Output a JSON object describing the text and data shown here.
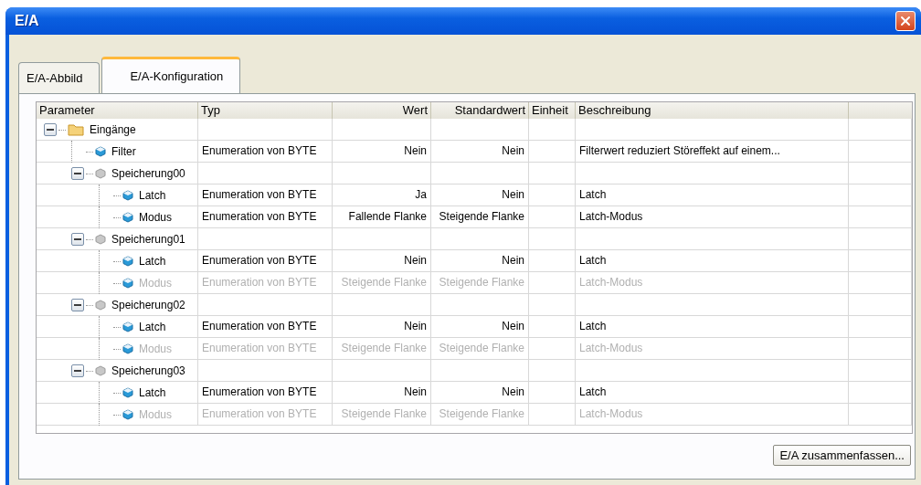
{
  "window": {
    "title": "E/A"
  },
  "tabs": [
    {
      "label": "E/A-Abbild",
      "selected": false
    },
    {
      "label": "E/A-Konfiguration",
      "selected": true
    }
  ],
  "table": {
    "columns": [
      "Parameter",
      "Typ",
      "Wert",
      "Standardwert",
      "Einheit",
      "Beschreibung"
    ],
    "rows": [
      {
        "kind": "folder",
        "name": "Eingänge",
        "expanded": true,
        "children": [
          {
            "kind": "leaf",
            "name": "Filter",
            "typ": "Enumeration von BYTE",
            "wert": "Nein",
            "standardwert": "Nein",
            "beschreibung": "Filterwert reduziert Störeffekt auf einem...",
            "disabled": false
          },
          {
            "kind": "group",
            "name": "Speicherung00",
            "expanded": true,
            "children": [
              {
                "kind": "leaf",
                "name": "Latch",
                "typ": "Enumeration von BYTE",
                "wert": "Ja",
                "standardwert": "Nein",
                "beschreibung": "Latch",
                "disabled": false
              },
              {
                "kind": "leaf",
                "name": "Modus",
                "typ": "Enumeration von BYTE",
                "wert": "Fallende Flanke",
                "standardwert": "Steigende Flanke",
                "beschreibung": "Latch-Modus",
                "disabled": false
              }
            ]
          },
          {
            "kind": "group",
            "name": "Speicherung01",
            "expanded": true,
            "children": [
              {
                "kind": "leaf",
                "name": "Latch",
                "typ": "Enumeration von BYTE",
                "wert": "Nein",
                "standardwert": "Nein",
                "beschreibung": "Latch",
                "disabled": false
              },
              {
                "kind": "leaf",
                "name": "Modus",
                "typ": "Enumeration von BYTE",
                "wert": "Steigende Flanke",
                "standardwert": "Steigende Flanke",
                "beschreibung": "Latch-Modus",
                "disabled": true
              }
            ]
          },
          {
            "kind": "group",
            "name": "Speicherung02",
            "expanded": true,
            "children": [
              {
                "kind": "leaf",
                "name": "Latch",
                "typ": "Enumeration von BYTE",
                "wert": "Nein",
                "standardwert": "Nein",
                "beschreibung": "Latch",
                "disabled": false
              },
              {
                "kind": "leaf",
                "name": "Modus",
                "typ": "Enumeration von BYTE",
                "wert": "Steigende Flanke",
                "standardwert": "Steigende Flanke",
                "beschreibung": "Latch-Modus",
                "disabled": true
              }
            ]
          },
          {
            "kind": "group",
            "name": "Speicherung03",
            "expanded": true,
            "children": [
              {
                "kind": "leaf",
                "name": "Latch",
                "typ": "Enumeration von BYTE",
                "wert": "Nein",
                "standardwert": "Nein",
                "beschreibung": "Latch",
                "disabled": false
              },
              {
                "kind": "leaf",
                "name": "Modus",
                "typ": "Enumeration von BYTE",
                "wert": "Steigende Flanke",
                "standardwert": "Steigende Flanke",
                "beschreibung": "Latch-Modus",
                "disabled": true
              }
            ]
          }
        ]
      }
    ]
  },
  "buttons": [
    "E/A zusammenfassen..."
  ]
}
